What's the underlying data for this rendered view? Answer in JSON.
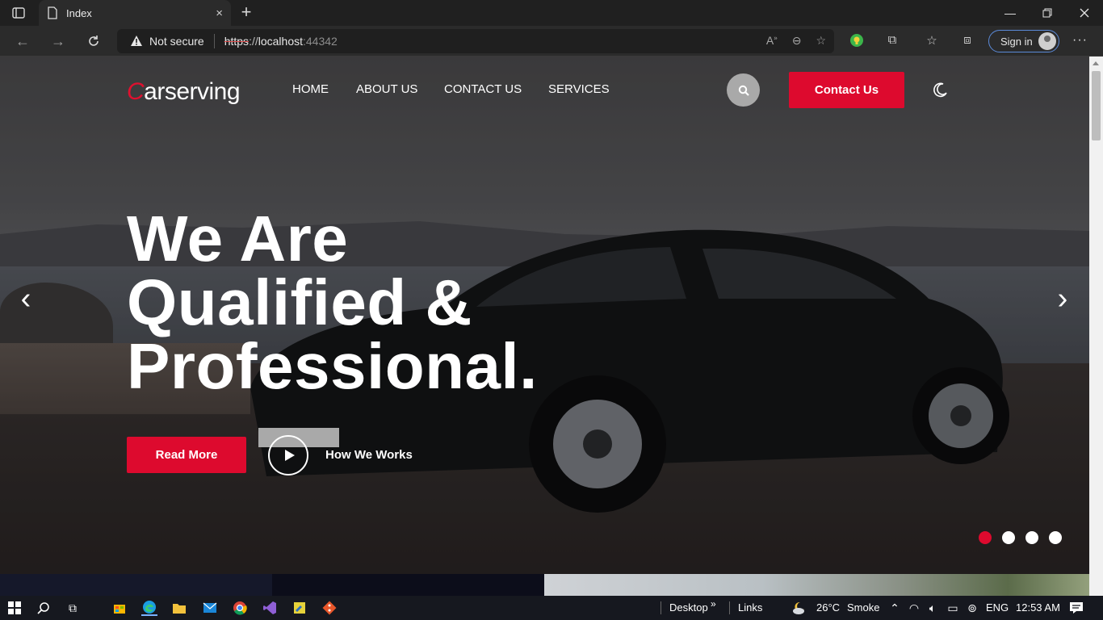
{
  "browser": {
    "tab_title": "Index",
    "close_label": "×",
    "new_tab_label": "+",
    "security_label": "Not secure",
    "url_proto": "https",
    "url_sep": "://",
    "url_host": "localhost",
    "url_port": ":44342",
    "sign_in_label": "Sign in",
    "more_label": "···"
  },
  "site": {
    "logo_initial": "C",
    "logo_rest": "arserving",
    "nav": [
      {
        "label": "HOME"
      },
      {
        "label": "ABOUT US"
      },
      {
        "label": "CONTACT US"
      },
      {
        "label": "SERVICES"
      }
    ],
    "contact_button": "Contact Us",
    "hero": {
      "line1": "We Are",
      "line2": "Qualified &",
      "line3": "Professional.",
      "read_more": "Read More",
      "how_we_works": "How We Works",
      "prev_arrow": "‹",
      "next_arrow": "›",
      "slide_count": 4,
      "active_slide": 1
    },
    "colors": {
      "accent": "#dd0a2e",
      "search_button": "#a9a9a9"
    }
  },
  "taskbar": {
    "desktop_label": "Desktop",
    "links_label": "Links",
    "weather_temp": "26°C",
    "weather_desc": "Smoke",
    "language": "ENG",
    "time": "12:53 AM"
  }
}
